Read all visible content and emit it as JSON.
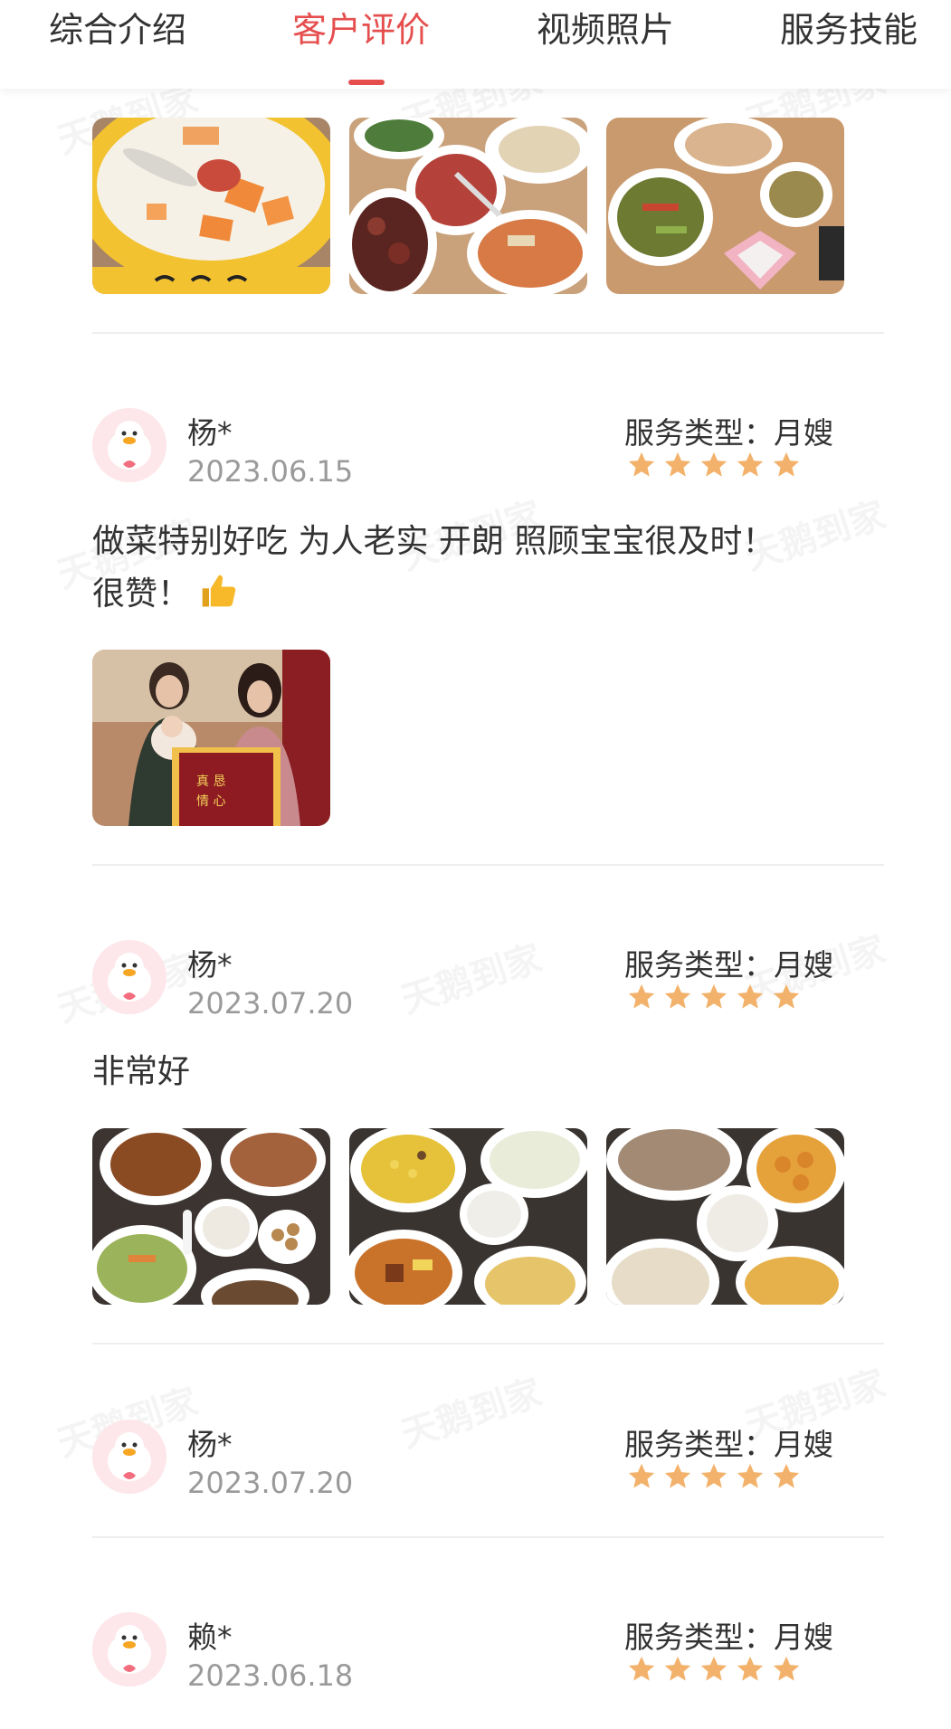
{
  "tabs": [
    {
      "label": "综合介绍"
    },
    {
      "label": "客户评价"
    },
    {
      "label": "视频照片"
    },
    {
      "label": "服务技能"
    }
  ],
  "active_tab": "客户评价",
  "watermark_text": "天鹅到家",
  "colors": {
    "accent": "#e64e4e",
    "star": "#f3b26b",
    "avatar_bg": "#fde7ea"
  },
  "reviews": [
    {
      "name": "杨*",
      "date": "2023.06.15",
      "service_type": "服务类型：月嫂",
      "rating": 5,
      "comment": "做菜特别好吃 为人老实 开朗 照顾宝宝很及时！很赞！",
      "emoji_icon": "thumbs-up-icon"
    },
    {
      "name": "杨*",
      "date": "2023.07.20",
      "service_type": "服务类型：月嫂",
      "rating": 5,
      "comment": "非常好"
    },
    {
      "name": "杨*",
      "date": "2023.07.20",
      "service_type": "服务类型：月嫂",
      "rating": 5
    },
    {
      "name": "赖*",
      "date": "2023.06.18",
      "service_type": "服务类型：月嫂",
      "rating": 5
    }
  ]
}
